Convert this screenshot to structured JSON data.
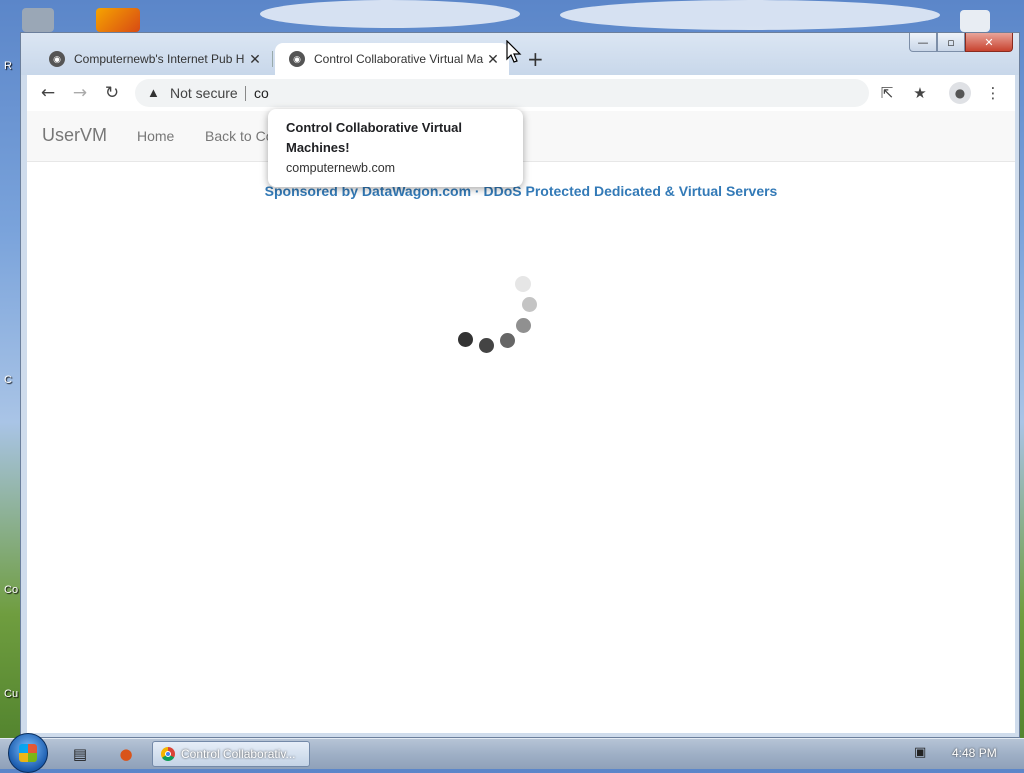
{
  "desktop": {
    "icon_labels": [
      "R",
      "C",
      "Co",
      "Cu"
    ]
  },
  "window": {
    "controls": {
      "minimize": "—",
      "restore": "▫",
      "close": "✕"
    }
  },
  "tabs": [
    {
      "title": "Computernewb's Internet Pub H",
      "close": "✕",
      "favicon": "mouse-favicon-icon",
      "active": false
    },
    {
      "title": "Control Collaborative Virtual Ma",
      "close": "✕",
      "favicon": "mouse-favicon-icon",
      "active": true
    }
  ],
  "new_tab": "+",
  "toolbar": {
    "back": "←",
    "forward": "→",
    "reload": "↻",
    "security_label": "Not secure",
    "url": "co",
    "share_icon": "share-icon",
    "star_icon": "★",
    "profile_icon": "profile-icon",
    "menu_icon": "⋮"
  },
  "tooltip": {
    "title": "Control Collaborative Virtual Machines!",
    "url": "computernewb.com"
  },
  "page": {
    "brand": "UserVM",
    "nav": [
      "Home",
      "Back to Co"
    ],
    "sponsor_link": "Sponsored by DataWagon.com",
    "sponsor_separator": " · ",
    "sponsor_text": "DDoS Protected Dedicated & Virtual Servers",
    "loading_spinner": "loading-spinner",
    "colors": {
      "sponsor": "#337ab7",
      "brand": "#777777"
    }
  },
  "taskbar": {
    "start": "start-orb",
    "pinned": [
      "file-explorer-icon",
      "firefox-icon"
    ],
    "task_label": "Control Collaborativ...",
    "clock": "4:48 PM"
  }
}
